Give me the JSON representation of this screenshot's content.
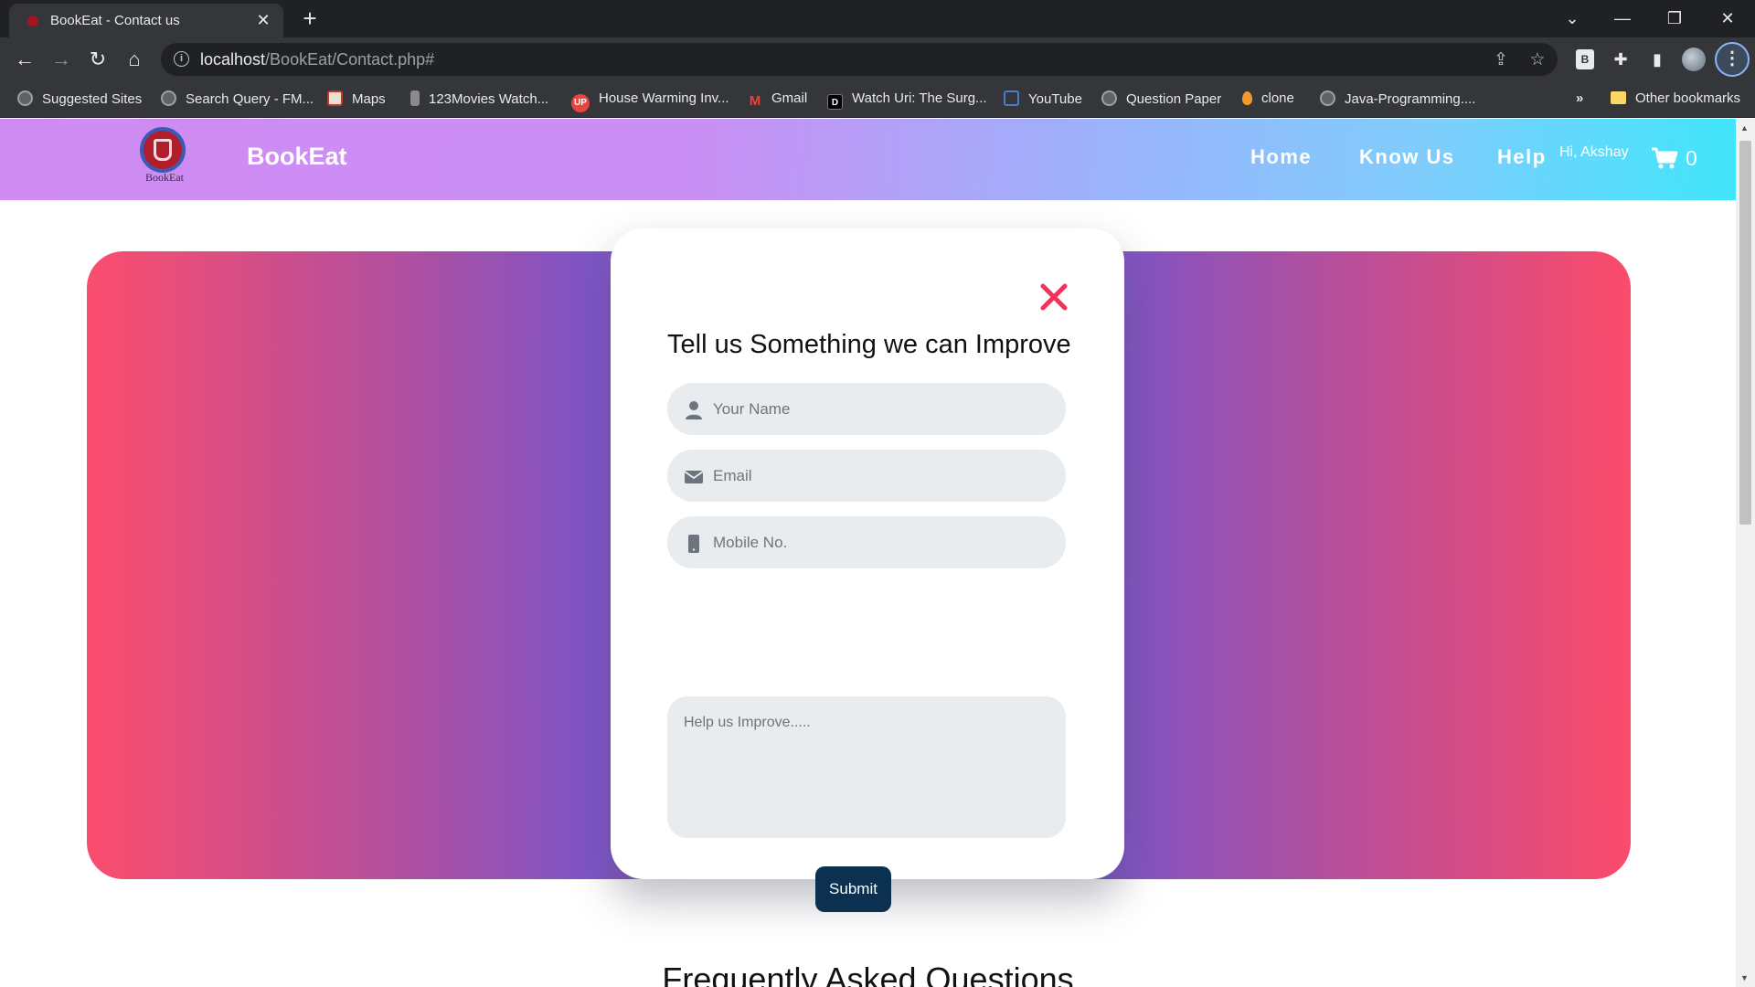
{
  "browser": {
    "tab_title": "BookEat - Contact us",
    "tab_close": "✕",
    "new_tab": "+",
    "url_host": "localhost",
    "url_path": "/BookEat/Contact.php#",
    "extension_label": "B",
    "bookmarks": [
      {
        "label": "Suggested Sites",
        "icon": "globe-icon"
      },
      {
        "label": "Search Query - FM...",
        "icon": "globe-icon"
      },
      {
        "label": "Maps",
        "icon": "maps-icon"
      },
      {
        "label": "123Movies Watch...",
        "icon": "movies-icon"
      },
      {
        "label": "House Warming Inv...",
        "icon": "up-icon"
      },
      {
        "label": "Gmail",
        "icon": "gmail-icon"
      },
      {
        "label": "Watch Uri: The Surg...",
        "icon": "d-icon"
      },
      {
        "label": "YouTube",
        "icon": "youtube-icon"
      },
      {
        "label": "Question Paper",
        "icon": "globe-icon"
      },
      {
        "label": "clone",
        "icon": "pin-icon"
      },
      {
        "label": "Java-Programming....",
        "icon": "globe-icon"
      }
    ],
    "bookmarks_overflow": "»",
    "other_bookmarks": "Other bookmarks"
  },
  "site": {
    "logo_text": "BookEat",
    "brand": "BookEat",
    "nav": {
      "home": "Home",
      "know_us": "Know Us",
      "help": "Help"
    },
    "greeting": "Hi, Akshay",
    "cart_count": "0"
  },
  "modal": {
    "title": "Tell us Something we can Improve",
    "name_placeholder": "Your Name",
    "email_placeholder": "Email",
    "mobile_placeholder": "Mobile No.",
    "message_placeholder": "Help us Improve.....",
    "submit_label": "Submit"
  },
  "faq": {
    "title": "Frequently Asked Questions"
  },
  "colors": {
    "nav_gradient_start": "#d08bf3",
    "nav_gradient_end": "#40e6fb",
    "hero_edge": "#fb4d6d",
    "hero_mid": "#7d55c8",
    "close_icon": "#f0335a",
    "submit_bg": "#0c3150"
  }
}
